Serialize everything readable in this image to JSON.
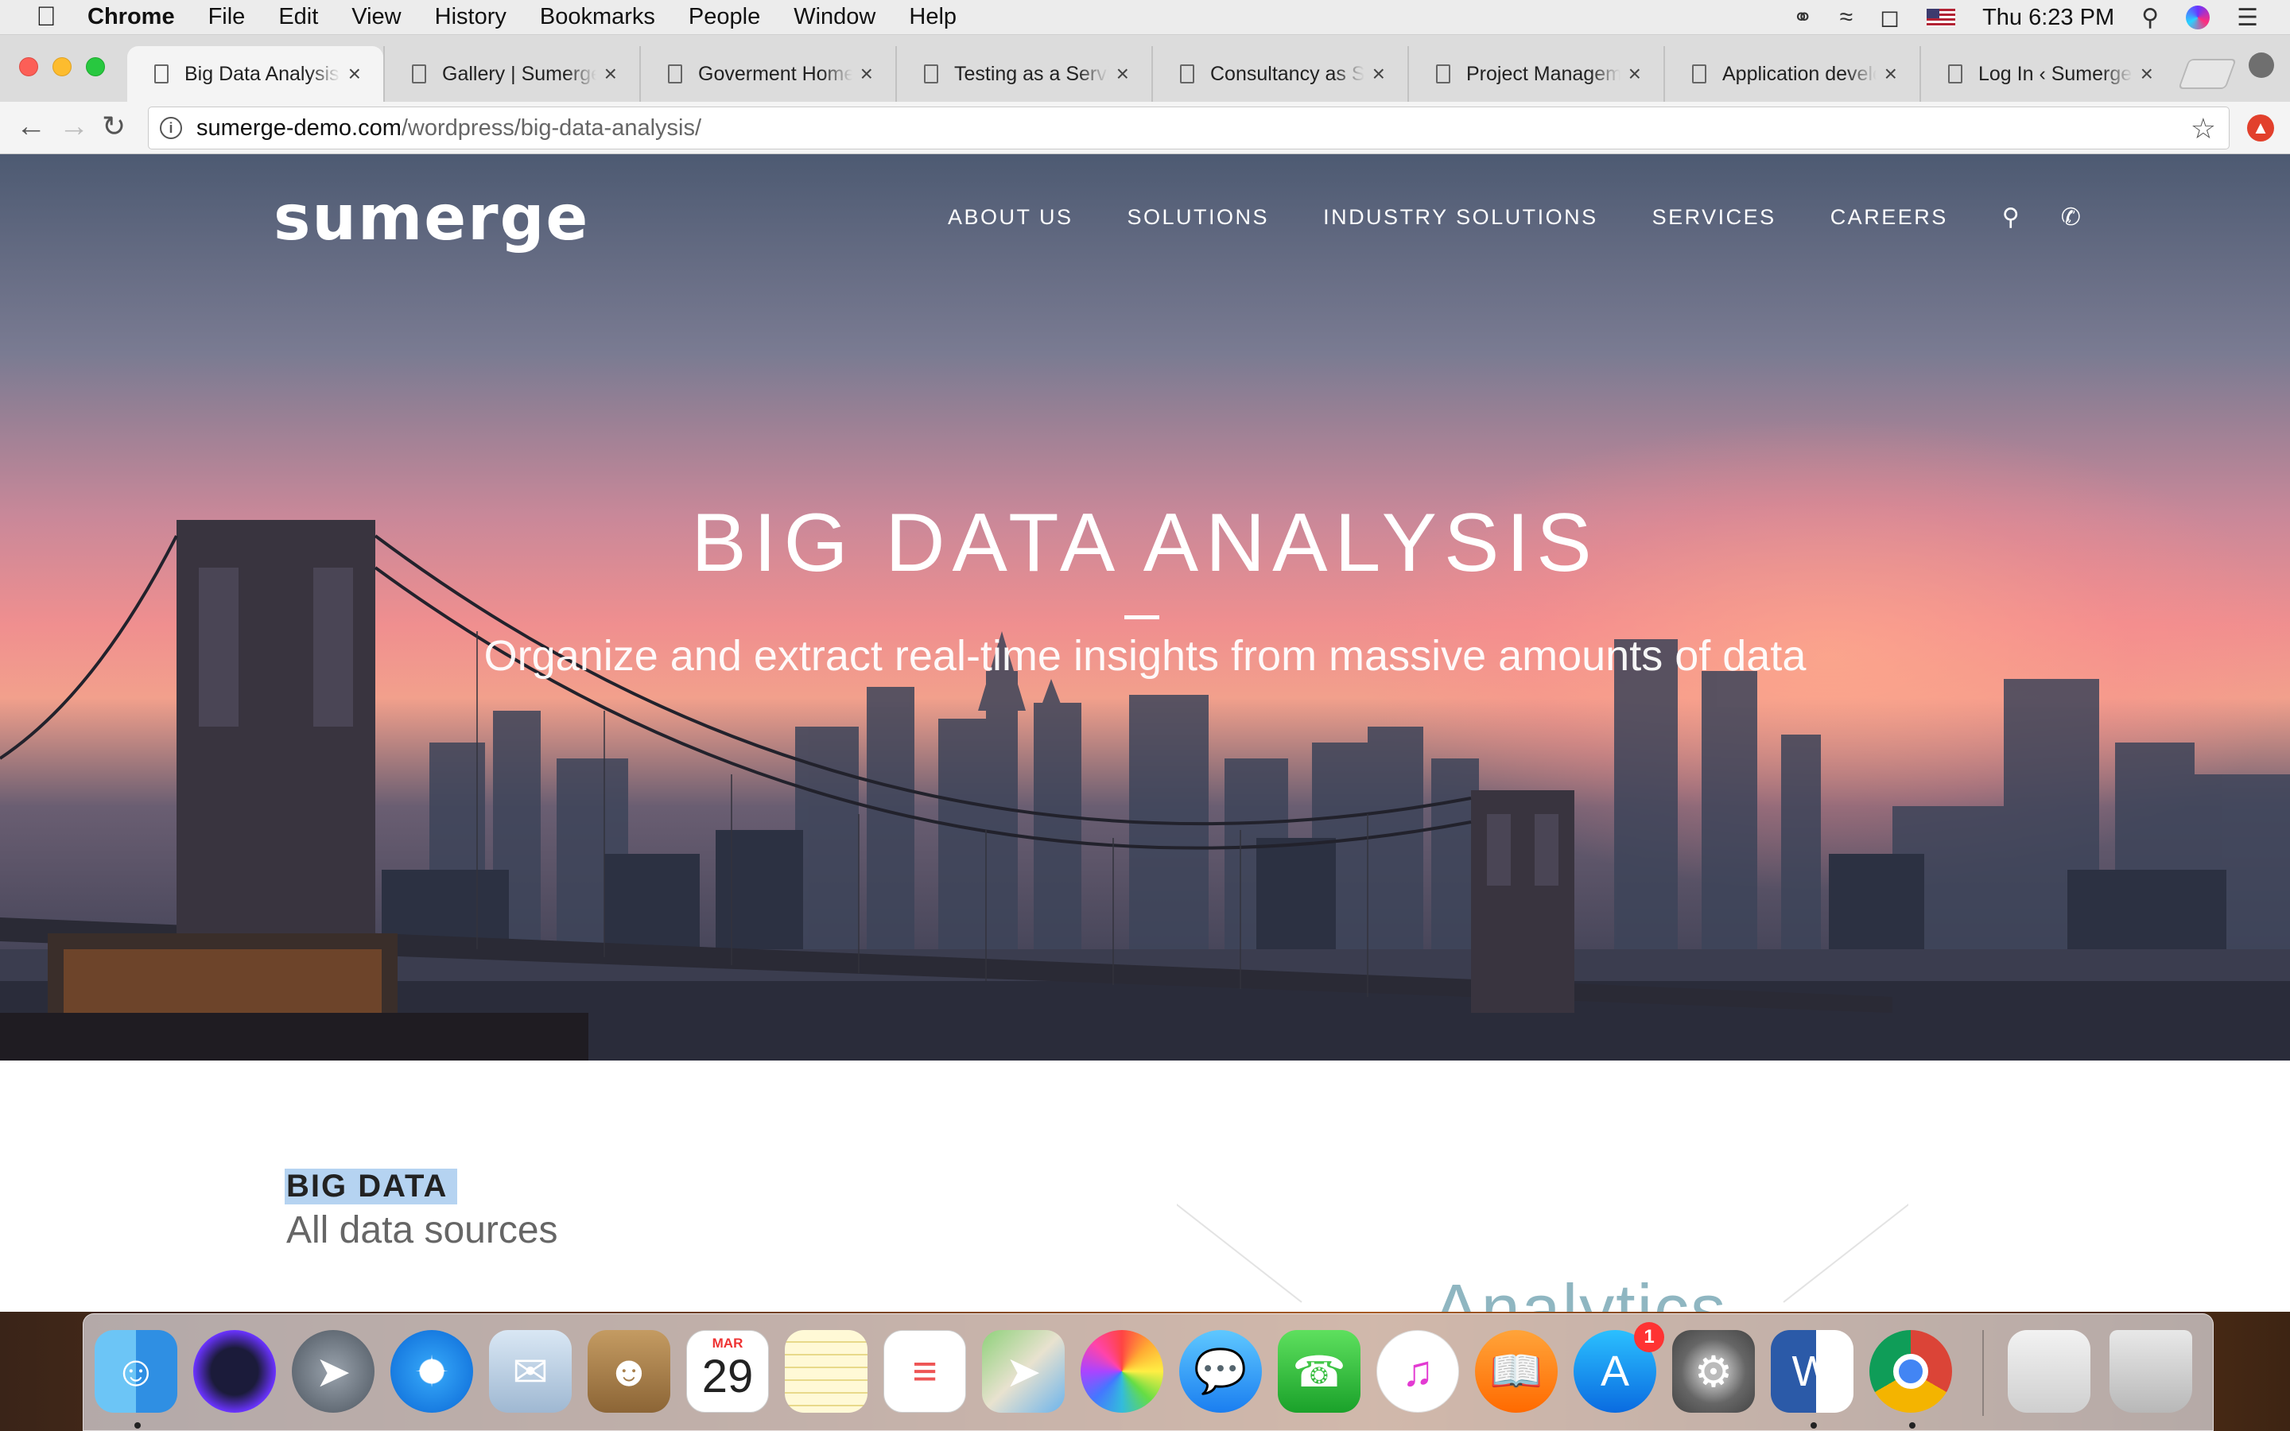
{
  "menubar": {
    "app_name": "Chrome",
    "menus": [
      "File",
      "Edit",
      "View",
      "History",
      "Bookmarks",
      "People",
      "Window",
      "Help"
    ],
    "clock": "Thu 6:23 PM",
    "status_icons": [
      "creative-cloud-icon",
      "wifi-icon",
      "battery-icon",
      "us-flag-icon",
      "search-icon",
      "siri-icon",
      "notification-center-icon"
    ]
  },
  "browser": {
    "tabs": [
      {
        "title": "Big Data Analysis | Sumerge",
        "active": true
      },
      {
        "title": "Gallery | Sumerge",
        "active": false
      },
      {
        "title": "Goverment Home | Sumerge",
        "active": false
      },
      {
        "title": "Testing as a Service | Sumerge",
        "active": false
      },
      {
        "title": "Consultancy as Service | Sumerge",
        "active": false
      },
      {
        "title": "Project Management | Sumerge",
        "active": false
      },
      {
        "title": "Application development | Sumerge",
        "active": false
      },
      {
        "title": "Log In ‹ Sumerge — WordPress",
        "active": false
      }
    ],
    "url_domain": "sumerge-demo.com",
    "url_path": "/wordpress/big-data-analysis/"
  },
  "site": {
    "logo": "sumerge",
    "nav": [
      "ABOUT US",
      "SOLUTIONS",
      "INDUSTRY SOLUTIONS",
      "SERVICES",
      "CAREERS"
    ],
    "hero_title": "BIG DATA ANALYSIS",
    "hero_subtitle": "Organize and extract real-time insights from massive amounts of data",
    "section_heading": "BIG DATA",
    "section_subheading": "All data sources",
    "graphic_word": "Analytics"
  },
  "dock": {
    "apps": [
      "Finder",
      "Siri",
      "Launchpad",
      "Safari",
      "Mail",
      "Contacts",
      "Calendar",
      "Notes",
      "Reminders",
      "Maps",
      "Photos",
      "Messages",
      "FaceTime",
      "iTunes",
      "iBooks",
      "App Store",
      "System Preferences",
      "Microsoft Word",
      "Google Chrome",
      "Downloads",
      "Trash"
    ],
    "calendar_month": "MAR",
    "calendar_day": "29",
    "app_store_badge": "1"
  }
}
